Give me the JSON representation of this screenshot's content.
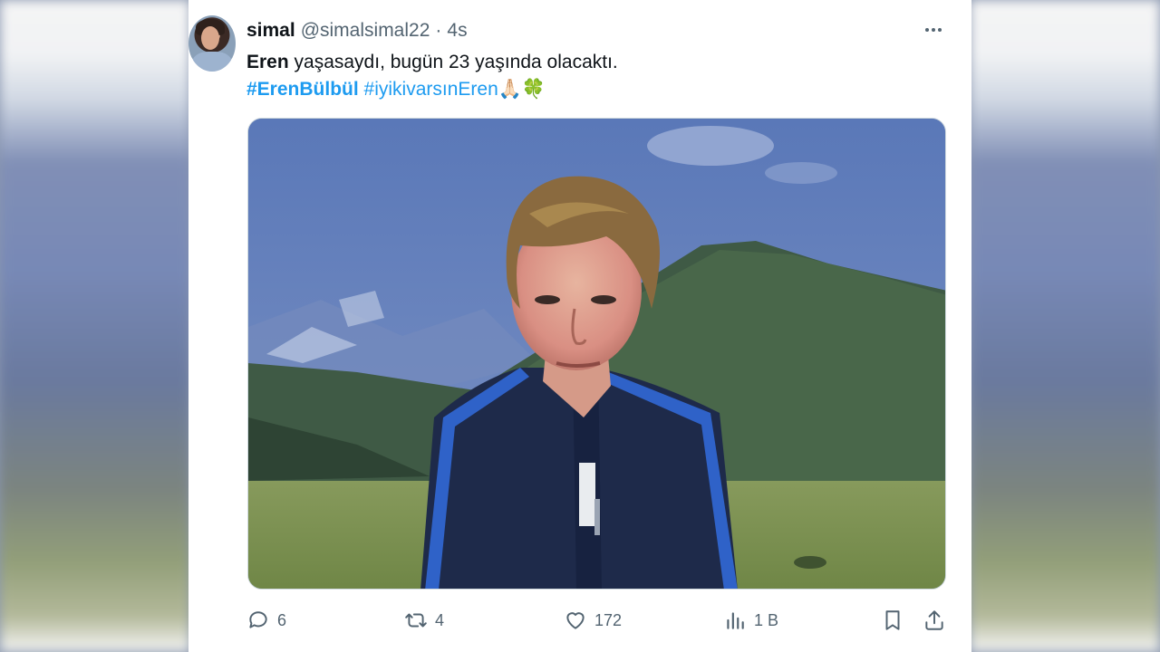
{
  "tweet": {
    "display_name": "simal",
    "handle": "@simalsimal22",
    "separator": "·",
    "time": "4s",
    "text_bold": "Eren",
    "text_rest": " yaşasaydı, bugün 23 yaşında olacaktı.",
    "hashtag_1": "#ErenBülbül",
    "hashtag_2": "#iyikivarsınEren",
    "emoji_hands": "🙏🏻",
    "emoji_clover": "🍀"
  },
  "actions": {
    "reply_count": "6",
    "retweet_count": "4",
    "like_count": "172",
    "views_count": "1 B"
  },
  "icons": {
    "more": "more-horizontal-icon",
    "reply": "reply-icon",
    "retweet": "retweet-icon",
    "like": "heart-icon",
    "views": "views-icon",
    "bookmark": "bookmark-icon",
    "share": "share-icon"
  },
  "colors": {
    "link": "#1d9bf0",
    "text": "#0f1419",
    "secondary": "#536471"
  }
}
